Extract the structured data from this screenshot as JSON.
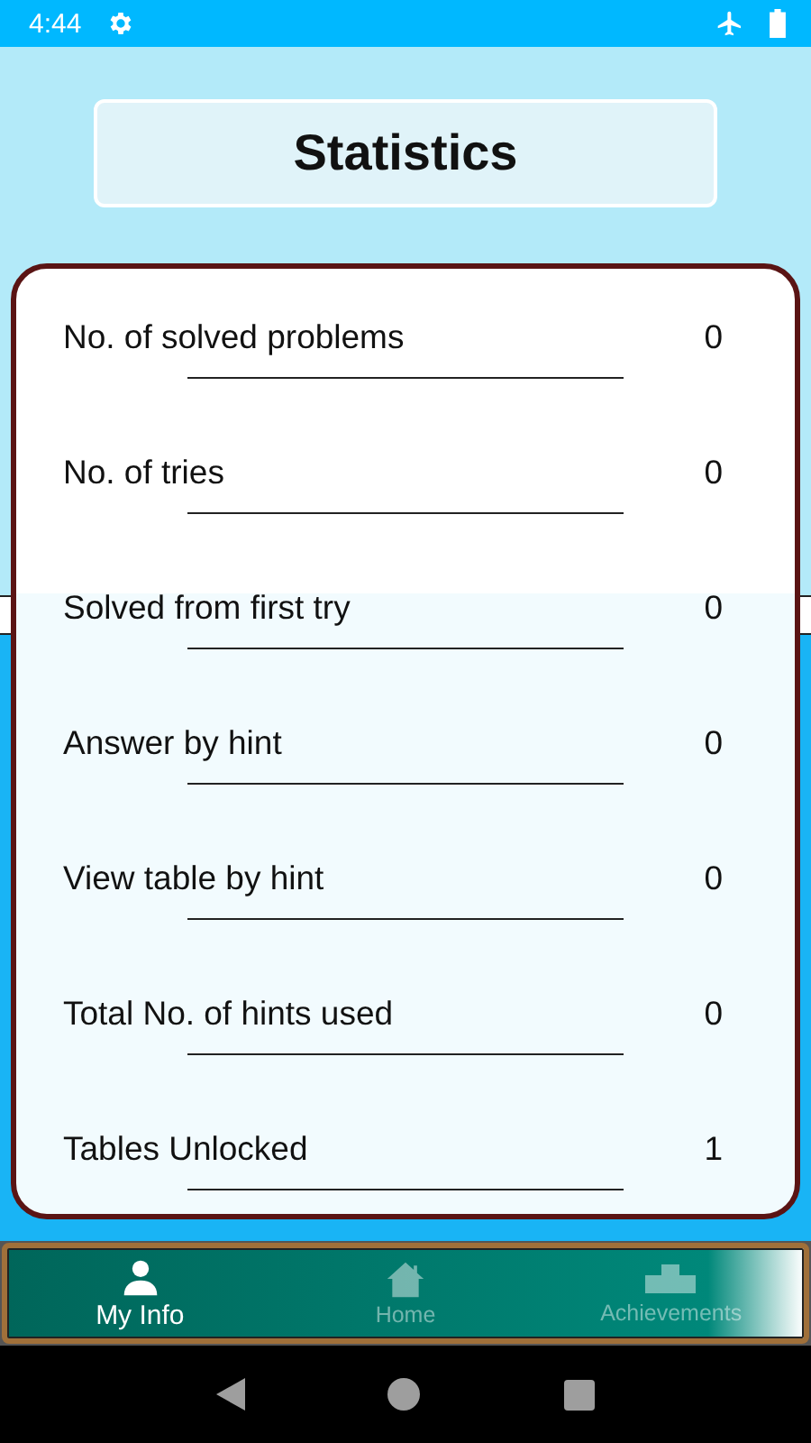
{
  "status_bar": {
    "time": "4:44"
  },
  "title": "Statistics",
  "stats": [
    {
      "label": "No. of solved problems",
      "value": "0"
    },
    {
      "label": "No. of tries",
      "value": "0"
    },
    {
      "label": "Solved from first try",
      "value": "0"
    },
    {
      "label": "Answer by hint",
      "value": "0"
    },
    {
      "label": "View table by hint",
      "value": "0"
    },
    {
      "label": "Total No. of hints used",
      "value": "0"
    },
    {
      "label": "Tables Unlocked",
      "value": "1"
    }
  ],
  "bottom_nav": [
    {
      "label": "My Info",
      "kind": "person",
      "selected": true
    },
    {
      "label": "Home",
      "kind": "home",
      "selected": false
    },
    {
      "label": "Achievements",
      "kind": "podium",
      "selected": false
    }
  ]
}
